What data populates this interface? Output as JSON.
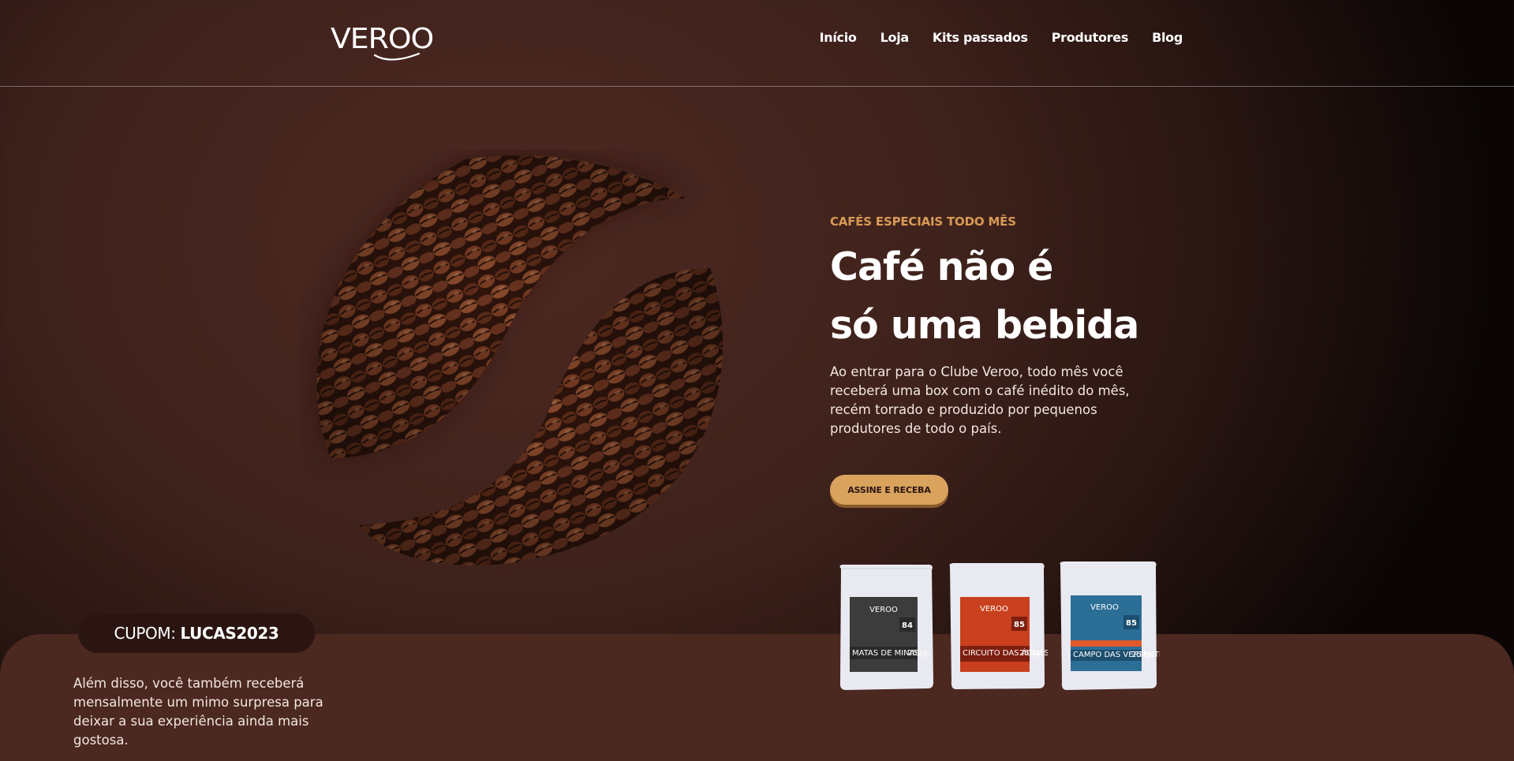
{
  "brand": {
    "logo_text": "VEROO"
  },
  "nav": {
    "items": [
      {
        "label": "Início"
      },
      {
        "label": "Loja"
      },
      {
        "label": "Kits passados"
      },
      {
        "label": "Produtores"
      },
      {
        "label": "Blog"
      }
    ]
  },
  "hero": {
    "eyebrow": "CAFÉS ESPECIAIS TODO MÊS",
    "headline_line1": "Café não é",
    "headline_line2": "só uma bebida",
    "description": "Ao entrar para o Clube Veroo, todo mês você receberá uma box com o café inédito do mês, recém torrado e produzido por pequenos produtores de todo o país.",
    "cta_label": "ASSINE E RECEBA"
  },
  "coupon": {
    "prefix": "CUPOM:",
    "code": "LUCAS2023"
  },
  "extra_text": "Além disso, você também receberá mensalmente um mimo surpresa para deixar a sua experiência ainda mais gostosa.",
  "products": [
    {
      "brand": "VEROO",
      "score": "84",
      "color": "#3c3c3c",
      "accent": "#2a2a2a",
      "region": "MATAS DE MINAS",
      "weight": "250g"
    },
    {
      "brand": "VEROO",
      "score": "85",
      "color": "#c8401d",
      "accent": "#7e1f10",
      "region": "CIRCUITO DAS ÁGUAS PAULISTA",
      "weight": "250g"
    },
    {
      "brand": "VEROO",
      "score": "85",
      "color": "#2b6e96",
      "accent": "#1c4e6e",
      "region": "CAMPO DAS VERTENTES",
      "weight": "250g"
    }
  ],
  "colors": {
    "accent": "#d9a35e",
    "eyebrow": "#d89a55",
    "panel": "#4b2820",
    "coupon_bg": "#2a1511"
  }
}
